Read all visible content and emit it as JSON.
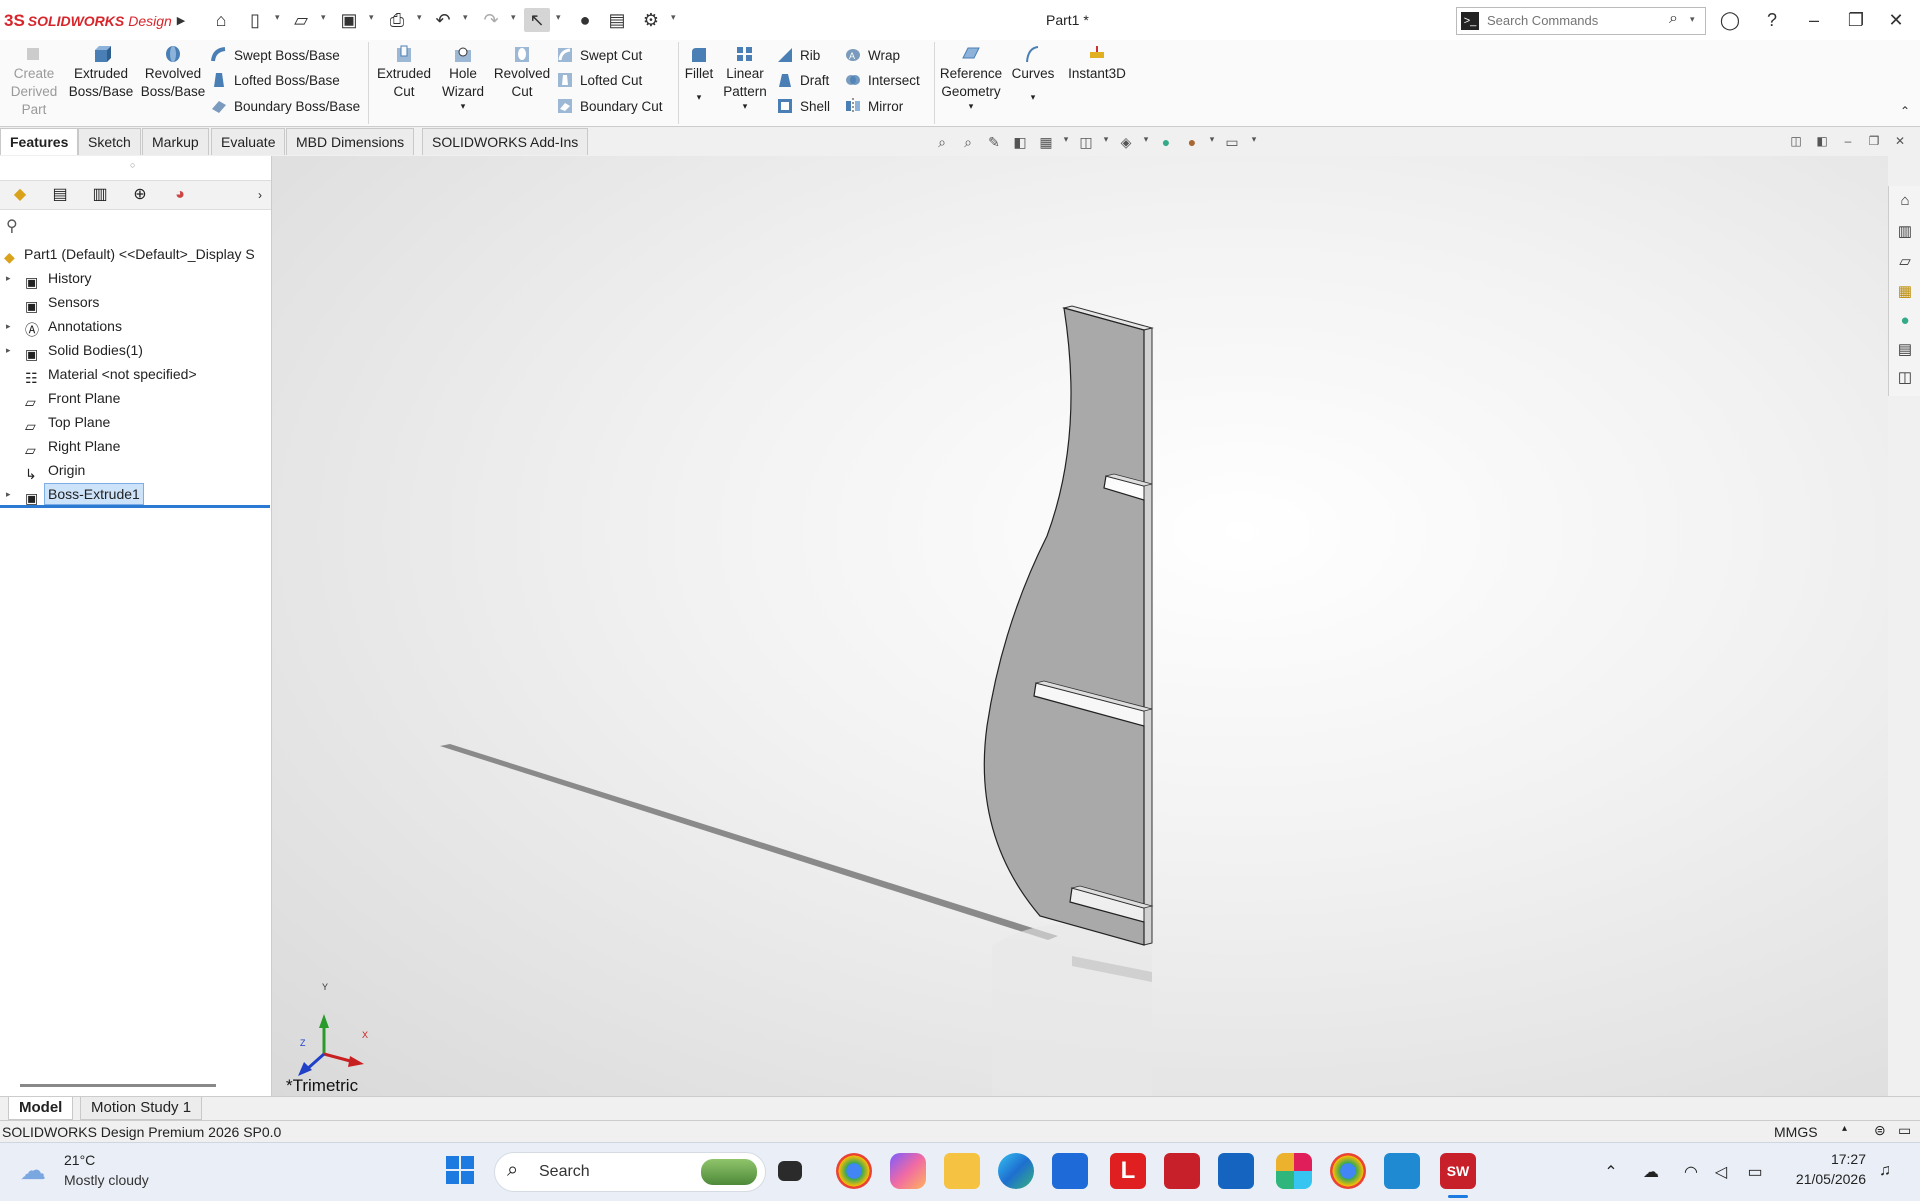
{
  "app": {
    "logo_ds": "3S",
    "logo_name": "SOLIDWORKS",
    "logo_edition": "Design",
    "document_title": "Part1 *",
    "search_placeholder": "Search Commands"
  },
  "ribbon": {
    "create_derived_part": [
      "Create",
      "Derived",
      "Part"
    ],
    "extruded_boss": [
      "Extruded",
      "Boss/Base"
    ],
    "revolved_boss": [
      "Revolved",
      "Boss/Base"
    ],
    "swept_boss": "Swept Boss/Base",
    "lofted_boss": "Lofted Boss/Base",
    "boundary_boss": "Boundary Boss/Base",
    "extruded_cut": [
      "Extruded",
      "Cut"
    ],
    "hole_wizard": [
      "Hole",
      "Wizard"
    ],
    "revolved_cut": [
      "Revolved",
      "Cut"
    ],
    "swept_cut": "Swept Cut",
    "lofted_cut": "Lofted Cut",
    "boundary_cut": "Boundary Cut",
    "fillet": "Fillet",
    "linear_pattern": [
      "Linear",
      "Pattern"
    ],
    "rib": "Rib",
    "draft": "Draft",
    "shell": "Shell",
    "wrap": "Wrap",
    "intersect": "Intersect",
    "mirror": "Mirror",
    "reference_geometry": [
      "Reference",
      "Geometry"
    ],
    "curves": "Curves",
    "instant3d": "Instant3D"
  },
  "command_tabs": [
    "Features",
    "Sketch",
    "Markup",
    "Evaluate",
    "MBD Dimensions",
    "SOLIDWORKS Add-Ins"
  ],
  "tree": {
    "root": "Part1 (Default) <<Default>_Display S",
    "items": [
      {
        "label": "History",
        "expandable": true,
        "icon": "history-icon"
      },
      {
        "label": "Sensors",
        "expandable": false,
        "icon": "sensors-icon"
      },
      {
        "label": "Annotations",
        "expandable": true,
        "icon": "annotations-icon"
      },
      {
        "label": "Solid Bodies(1)",
        "expandable": true,
        "icon": "solid-bodies-icon"
      },
      {
        "label": "Material <not specified>",
        "expandable": false,
        "icon": "material-icon"
      },
      {
        "label": "Front Plane",
        "expandable": false,
        "icon": "plane-icon"
      },
      {
        "label": "Top Plane",
        "expandable": false,
        "icon": "plane-icon"
      },
      {
        "label": "Right Plane",
        "expandable": false,
        "icon": "plane-icon"
      },
      {
        "label": "Origin",
        "expandable": false,
        "icon": "origin-icon"
      },
      {
        "label": "Boss-Extrude1",
        "expandable": true,
        "icon": "boss-extrude-icon",
        "selected": true
      }
    ]
  },
  "viewport": {
    "view_name": "*Trimetric",
    "axis_x": "X",
    "axis_y": "Y",
    "axis_z": "Z"
  },
  "bottom_tabs": [
    "Model",
    "Motion Study 1"
  ],
  "status": {
    "product": "SOLIDWORKS Design Premium 2026 SP0.0",
    "units": "MMGS"
  },
  "taskbar": {
    "weather_temp": "21°C",
    "weather_desc": "Mostly cloudy",
    "search_label": "Search",
    "time": "17:27",
    "date": "21/05/2026"
  },
  "colors": {
    "brand_red": "#d6262c",
    "part_gray": "#a9a9a9",
    "selection_blue": "#cde3fa"
  }
}
